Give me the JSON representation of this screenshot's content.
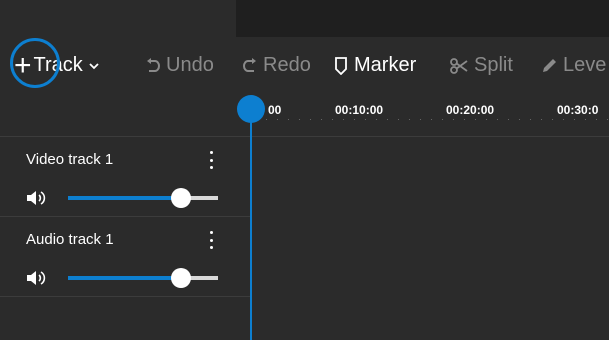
{
  "toolbar": {
    "add_track": {
      "label": "Track",
      "icon": "plus-icon"
    },
    "undo": {
      "label": "Undo",
      "icon": "undo-icon",
      "enabled": false
    },
    "redo": {
      "label": "Redo",
      "icon": "redo-icon",
      "enabled": false
    },
    "marker": {
      "label": "Marker",
      "icon": "marker-icon",
      "enabled": true
    },
    "split": {
      "label": "Split",
      "icon": "scissors-icon",
      "enabled": false
    },
    "level": {
      "label": "Leve",
      "icon": "pencil-icon",
      "enabled": false
    }
  },
  "ruler": {
    "ticks": [
      "00",
      "00:10:00",
      "00:20:00",
      "00:30:0"
    ]
  },
  "tracks": [
    {
      "name": "Video track 1",
      "volume": 0.75
    },
    {
      "name": "Audio track 1",
      "volume": 0.75
    }
  ],
  "colors": {
    "accent": "#0d7fd0",
    "background": "#2b2b2b",
    "disabled_text": "#8a8a8a"
  }
}
